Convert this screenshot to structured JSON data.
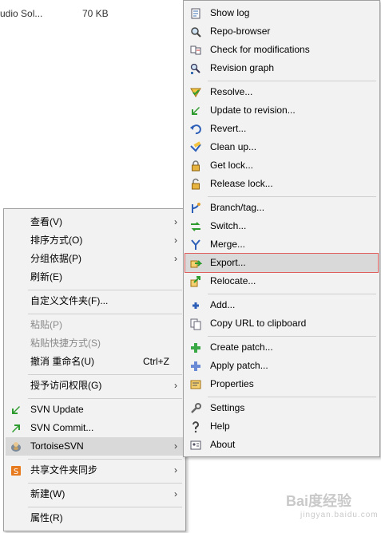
{
  "file": {
    "name": "udio Sol...",
    "size": "70 KB"
  },
  "main_menu": {
    "items": [
      {
        "label": "查看(V)",
        "submenu": true
      },
      {
        "label": "排序方式(O)",
        "submenu": true
      },
      {
        "label": "分组依据(P)",
        "submenu": true
      },
      {
        "label": "刷新(E)"
      },
      {
        "label": "自定义文件夹(F)..."
      },
      {
        "label": "粘贴(P)",
        "disabled": true
      },
      {
        "label": "粘贴快捷方式(S)",
        "disabled": true
      },
      {
        "label": "撤消 重命名(U)",
        "shortcut": "Ctrl+Z"
      },
      {
        "label": "授予访问权限(G)",
        "submenu": true
      },
      {
        "label": "SVN Update",
        "icon": "svn-update-icon"
      },
      {
        "label": "SVN Commit...",
        "icon": "svn-commit-icon"
      },
      {
        "label": "TortoiseSVN",
        "icon": "tortoisesvn-icon",
        "submenu": true,
        "highlighted": true
      },
      {
        "label": "共享文件夹同步",
        "icon": "share-sync-icon",
        "submenu": true
      },
      {
        "label": "新建(W)",
        "submenu": true
      },
      {
        "label": "属性(R)"
      }
    ]
  },
  "svn_menu": {
    "items": [
      {
        "label": "Show log",
        "icon": "show-log-icon"
      },
      {
        "label": "Repo-browser",
        "icon": "repo-browser-icon"
      },
      {
        "label": "Check for modifications",
        "icon": "check-modifications-icon"
      },
      {
        "label": "Revision graph",
        "icon": "revision-graph-icon"
      },
      {
        "label": "Resolve...",
        "icon": "resolve-icon"
      },
      {
        "label": "Update to revision...",
        "icon": "update-to-revision-icon"
      },
      {
        "label": "Revert...",
        "icon": "revert-icon"
      },
      {
        "label": "Clean up...",
        "icon": "clean-up-icon"
      },
      {
        "label": "Get lock...",
        "icon": "lock-icon"
      },
      {
        "label": "Release lock...",
        "icon": "unlock-icon"
      },
      {
        "label": "Branch/tag...",
        "icon": "branch-icon"
      },
      {
        "label": "Switch...",
        "icon": "switch-icon"
      },
      {
        "label": "Merge...",
        "icon": "merge-icon"
      },
      {
        "label": "Export...",
        "icon": "export-icon",
        "highlighted": true
      },
      {
        "label": "Relocate...",
        "icon": "relocate-icon"
      },
      {
        "label": "Add...",
        "icon": "add-icon"
      },
      {
        "label": "Copy URL to clipboard",
        "icon": "copy-url-icon"
      },
      {
        "label": "Create patch...",
        "icon": "create-patch-icon"
      },
      {
        "label": "Apply patch...",
        "icon": "apply-patch-icon"
      },
      {
        "label": "Properties",
        "icon": "properties-icon"
      },
      {
        "label": "Settings",
        "icon": "settings-icon"
      },
      {
        "label": "Help",
        "icon": "help-icon"
      },
      {
        "label": "About",
        "icon": "about-icon"
      }
    ]
  },
  "watermark": {
    "text": "Bai度经验",
    "sub": "jingyan.baidu.com"
  },
  "colors": {
    "menu_bg": "#f2f2f2",
    "highlight": "#d9d9d9",
    "export_outline": "#e06060"
  }
}
